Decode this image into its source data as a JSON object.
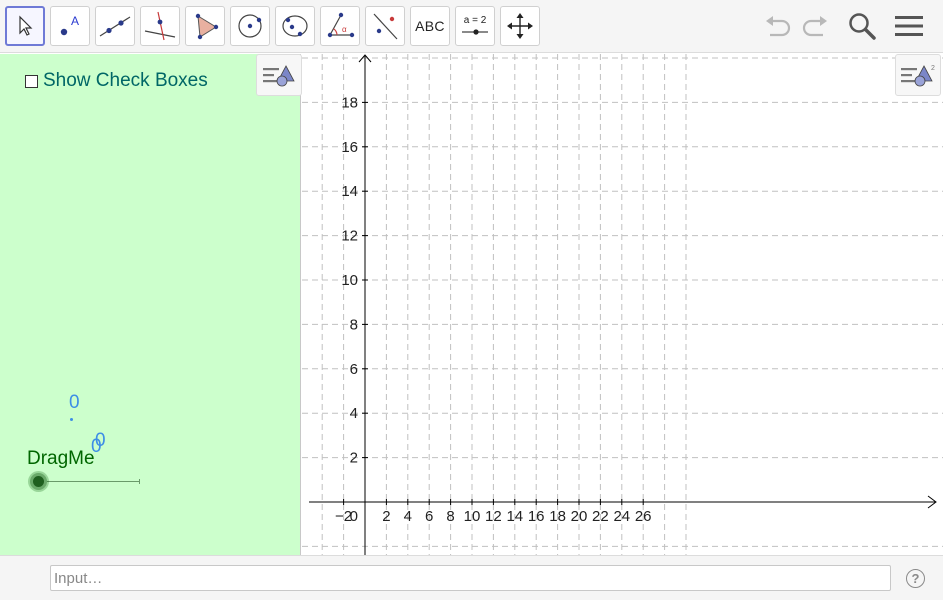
{
  "toolbar": {
    "tools": [
      {
        "name": "move-tool",
        "icon": "cursor-arrow-icon",
        "selected": true
      },
      {
        "name": "point-tool",
        "icon": "point-icon"
      },
      {
        "name": "line-tool",
        "icon": "line-through-points-icon"
      },
      {
        "name": "perpendicular-line-tool",
        "icon": "perpendicular-line-icon"
      },
      {
        "name": "polygon-tool",
        "icon": "polygon-icon"
      },
      {
        "name": "circle-tool",
        "icon": "circle-center-point-icon"
      },
      {
        "name": "circle-three-points-tool",
        "icon": "circle-three-points-icon"
      },
      {
        "name": "angle-tool",
        "icon": "angle-icon"
      },
      {
        "name": "reflect-tool",
        "icon": "reflect-about-line-icon"
      },
      {
        "name": "text-tool",
        "icon": "text-icon",
        "label": "ABC"
      },
      {
        "name": "slider-tool",
        "icon": "slider-icon",
        "label": "a = 2"
      },
      {
        "name": "move-graphics-view-tool",
        "icon": "move-arrows-icon"
      }
    ],
    "undo_icon": "undo-icon",
    "redo_icon": "redo-icon",
    "search_icon": "search-icon",
    "menu_icon": "hamburger-menu-icon"
  },
  "algebra": {
    "show_checkboxes_label": "Show Check Boxes",
    "show_checkboxes_checked": false,
    "value_upper": "0",
    "value_lower": "0",
    "value_lower_overlap": "0",
    "slider_label": "DragMe",
    "slider_value_fraction": 0,
    "background_color": "#ccffcc"
  },
  "graphics": {
    "x_tick_labels": [
      "−2",
      "0",
      "2",
      "4",
      "6",
      "8",
      "10",
      "12",
      "14",
      "16",
      "18",
      "20",
      "22",
      "24",
      "26"
    ],
    "y_tick_labels": [
      "2",
      "4",
      "6",
      "8",
      "10",
      "12",
      "14",
      "16",
      "18"
    ],
    "grid": "dashed",
    "grid_color": "#c0c0c0"
  },
  "input_bar": {
    "placeholder": "Input…",
    "help_label": "?"
  },
  "colors": {
    "selected_tool_border": "#6f7ad6",
    "slider_label_color": "#006600",
    "value_color": "#3d8ee6",
    "checkbox_label_color": "#006666"
  }
}
